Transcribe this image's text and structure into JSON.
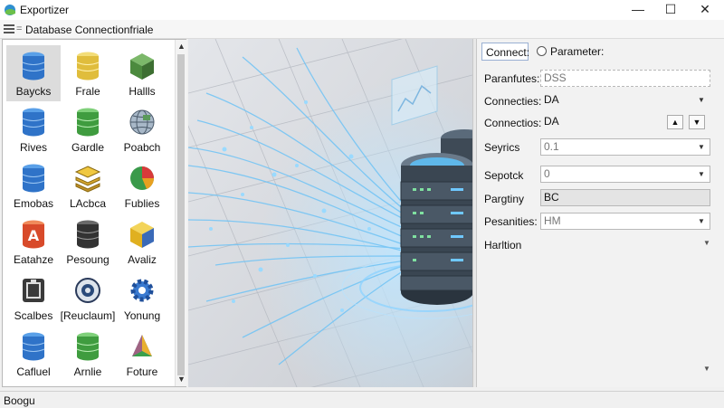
{
  "window": {
    "title": "Exportizer"
  },
  "toolbar": {
    "title": "Database Connectionfriale"
  },
  "palette": {
    "items": [
      {
        "label": "Baycks",
        "icon": "database-blue-icon"
      },
      {
        "label": "Frale",
        "icon": "database-yellow-icon"
      },
      {
        "label": "Hallls",
        "icon": "cube-green-icon"
      },
      {
        "label": "Rives",
        "icon": "database-blue-icon"
      },
      {
        "label": "Gardle",
        "icon": "database-green-icon"
      },
      {
        "label": "Poabch",
        "icon": "globe-icon"
      },
      {
        "label": "Emobas",
        "icon": "database-blue-icon"
      },
      {
        "label": "LAcbca",
        "icon": "layers-yellow-icon"
      },
      {
        "label": "Fublies",
        "icon": "pie-chart-icon"
      },
      {
        "label": "Eatahze",
        "icon": "access-icon"
      },
      {
        "label": "Pesoung",
        "icon": "database-dark-icon"
      },
      {
        "label": "Avaliz",
        "icon": "cube-yellow-icon"
      },
      {
        "label": "Scalbes",
        "icon": "frame-icon"
      },
      {
        "label": "[Reuclaum]",
        "icon": "settings-globe-icon"
      },
      {
        "label": "Yonung",
        "icon": "gear-icon"
      },
      {
        "label": "Cafluel",
        "icon": "database-blue-icon"
      },
      {
        "label": "Arnlie",
        "icon": "database-green-icon"
      },
      {
        "label": "Foture",
        "icon": "prism-icon"
      }
    ]
  },
  "properties": {
    "tab_active": "Connect:",
    "tab_other": "Parameter:",
    "rows": [
      {
        "label": "Paranfutes:",
        "value": "DSS",
        "dim": true
      },
      {
        "label": "Connecties:",
        "value": "DA"
      },
      {
        "label": "Connectios:",
        "value": "DA"
      },
      {
        "label": "Seyrics",
        "value": "0.1",
        "dim": true
      },
      {
        "label": "Sepotck",
        "value": "0",
        "dim": true
      },
      {
        "label": "Pargtiny",
        "value": "BC"
      },
      {
        "label": "Pesanities:",
        "value": "HM",
        "dim": true
      },
      {
        "label": "Harltion",
        "value": ""
      }
    ]
  },
  "status": {
    "text": "Boogu"
  },
  "colors": {
    "accent": "#9ab0d3",
    "db_blue": "#3b7dd8",
    "db_green": "#4aa04a",
    "db_yellow": "#e6c84a"
  }
}
